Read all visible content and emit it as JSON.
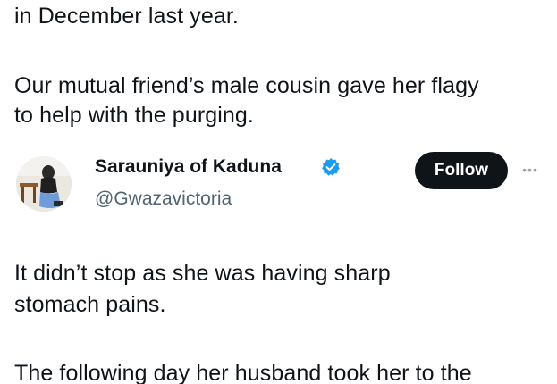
{
  "upper_post": {
    "lines": [
      "in December last year.",
      "Our mutual friend’s male cousin gave her flagy",
      "to help with the purging."
    ]
  },
  "tweet": {
    "author_name": "Sarauniya of Kaduna",
    "author_handle": "@Gwazavictoria",
    "follow_label": "Follow",
    "verified": true,
    "verified_color": "#1d9bf0",
    "more_icon": "more-horizontal-icon",
    "body_lines": [
      "It didn’t stop as she was having sharp",
      "stomach pains.",
      "The following day her husband took her to the"
    ]
  }
}
